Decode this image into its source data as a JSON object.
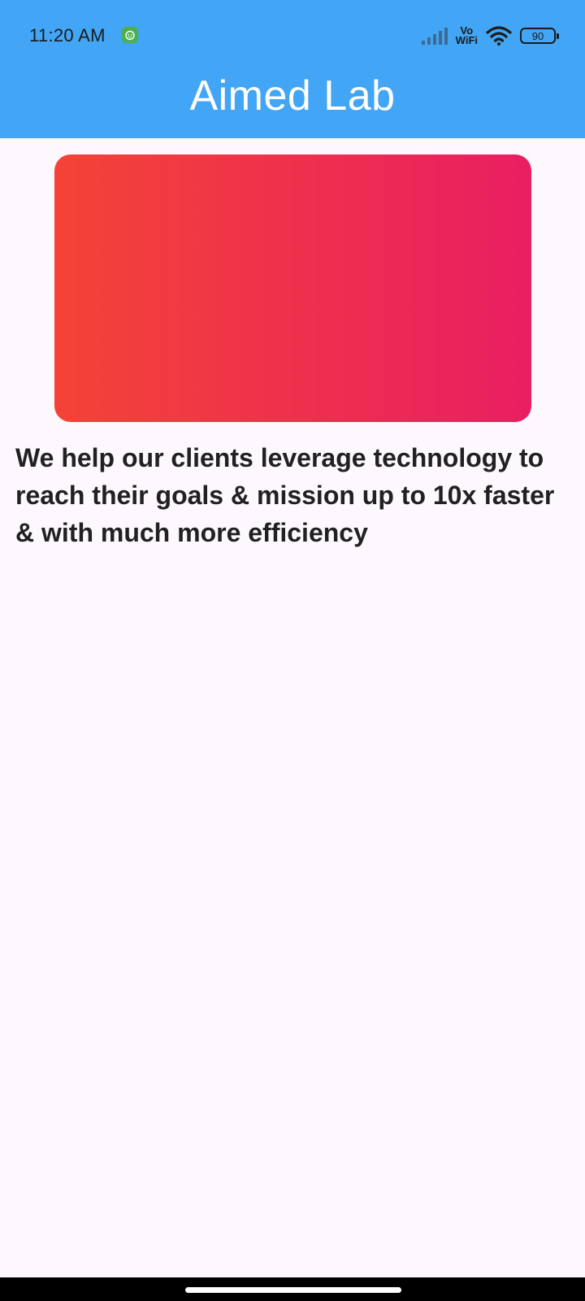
{
  "status_bar": {
    "time": "11:20 AM",
    "notification_icon": "android-face-icon",
    "network": "Vo WiFi",
    "network_top": "Vo",
    "network_bottom": "WiFi",
    "battery": "90"
  },
  "app_bar": {
    "title": "Aimed Lab",
    "background_color": "#42a5f5"
  },
  "banner": {
    "gradient_start": "#f44336",
    "gradient_end": "#e91e63"
  },
  "content": {
    "tagline": "We help our clients leverage technology to reach their goals & mission up to 10x faster & with much more efficiency"
  }
}
